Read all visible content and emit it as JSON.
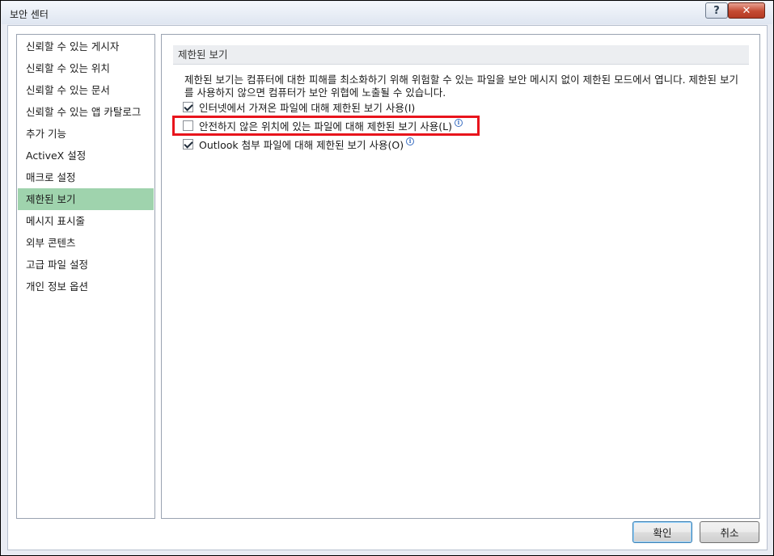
{
  "window": {
    "title": "보안 센터",
    "help_label": "?",
    "close_label": "✕"
  },
  "nav": {
    "selected_index": 7,
    "items": [
      {
        "label": "신뢰할 수 있는 게시자"
      },
      {
        "label": "신뢰할 수 있는 위치"
      },
      {
        "label": "신뢰할 수 있는 문서"
      },
      {
        "label": "신뢰할 수 있는 앱 카탈로그"
      },
      {
        "label": "추가 기능"
      },
      {
        "label": "ActiveX 설정"
      },
      {
        "label": "매크로 설정"
      },
      {
        "label": "제한된 보기"
      },
      {
        "label": "메시지 표시줄"
      },
      {
        "label": "외부 콘텐츠"
      },
      {
        "label": "고급 파일 설정"
      },
      {
        "label": "개인 정보 옵션"
      }
    ]
  },
  "content": {
    "section_title": "제한된 보기",
    "description": "제한된 보기는 컴퓨터에 대한 피해를 최소화하기 위해 위험할 수 있는 파일을 보안 메시지 없이 제한된 모드에서 엽니다. 제한된 보기를 사용하지 않으면 컴퓨터가 보안 위협에 노출될 수 있습니다.",
    "options": [
      {
        "label": "인터넷에서 가져온 파일에 대해 제한된 보기 사용(I)",
        "checked": true,
        "info": false
      },
      {
        "label": "안전하지 않은 위치에 있는 파일에 대해 제한된 보기 사용(L)",
        "checked": false,
        "info": true
      },
      {
        "label": "Outlook 첨부 파일에 대해 제한된 보기 사용(O)",
        "checked": true,
        "info": true
      }
    ],
    "info_icon_glyph": "i"
  },
  "footer": {
    "ok_label": "확인",
    "cancel_label": "취소"
  },
  "colors": {
    "selected_nav_bg": "#9fd3ad",
    "highlight_border": "#e8141c"
  }
}
